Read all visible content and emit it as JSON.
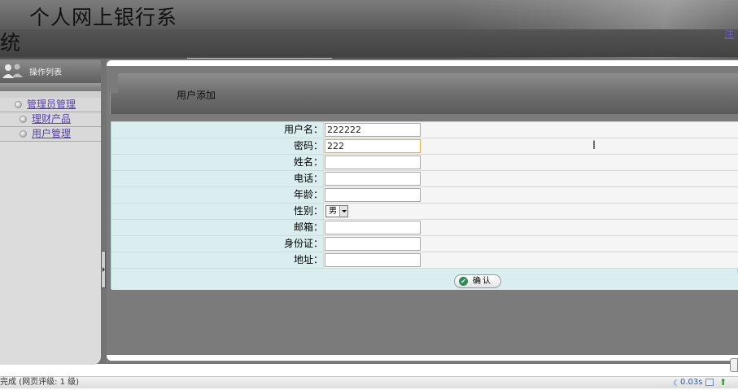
{
  "header": {
    "title_line1": "个人网上银行系",
    "title_line2": "统",
    "logout_link": "注"
  },
  "sidebar": {
    "title": "操作列表",
    "items": [
      {
        "label": "管理员管理"
      },
      {
        "label": "理财产品"
      },
      {
        "label": "用户管理"
      }
    ]
  },
  "main": {
    "page_title": "用户添加",
    "form": {
      "fields": [
        {
          "label": "用户名：",
          "value": "222222"
        },
        {
          "label": "密码：",
          "value": "222"
        },
        {
          "label": "姓名：",
          "value": ""
        },
        {
          "label": "电话：",
          "value": ""
        },
        {
          "label": "年龄：",
          "value": ""
        },
        {
          "label": "性别：",
          "value": "男"
        },
        {
          "label": "邮箱：",
          "value": ""
        },
        {
          "label": "身份证：",
          "value": ""
        },
        {
          "label": "地址：",
          "value": ""
        }
      ],
      "confirm_label": "确认"
    }
  },
  "statusbar": {
    "status_text": "完成 (网页评级: 1 级)",
    "load_time": "0.03s"
  },
  "colors": {
    "header_bg": "#5e5e5e",
    "form_bg": "#daeef0",
    "link": "#5a3fb0",
    "focus_border": "#e3b44a"
  },
  "icons": [
    "users-icon",
    "bullet-icon",
    "check-icon",
    "dropdown-arrow-icon",
    "moon-icon",
    "window-icon",
    "connection-icon"
  ]
}
